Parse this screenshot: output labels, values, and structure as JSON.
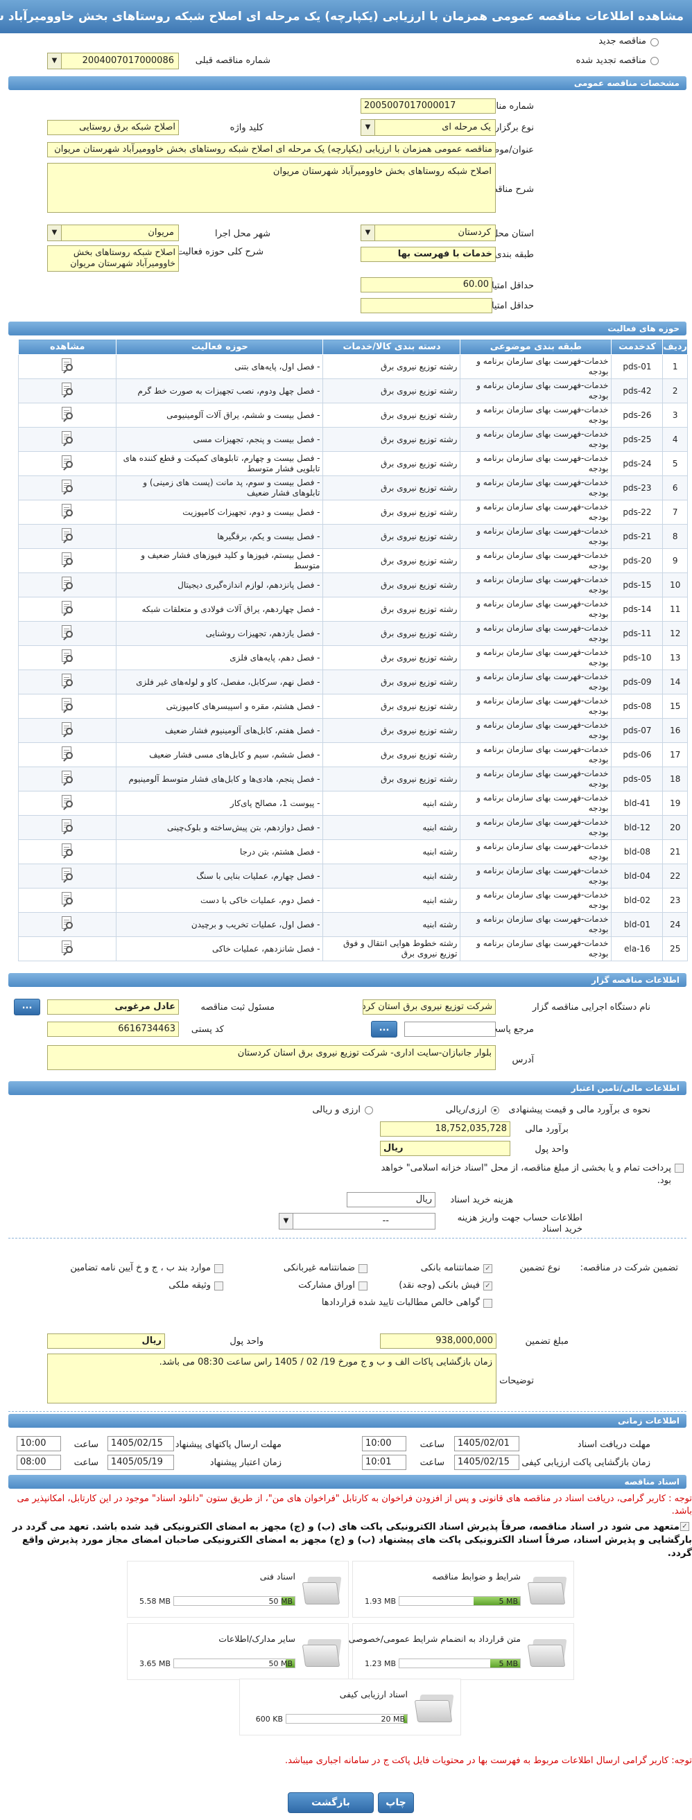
{
  "title": "مشاهده اطلاعات مناقصه عمومی همزمان با ارزیابی (یکپارچه) یک مرحله ای اصلاح شبکه روستاهای بخش خاوومیرآباد شهرستان مریوان",
  "top": {
    "new_tender": "مناقصه جدید",
    "renewed_tender": "مناقصه تجدید شده",
    "prev_number_label": "شماره مناقصه قبلی",
    "prev_number": "2004007017000086"
  },
  "sections": {
    "general": "مشخصات مناقصه عمومی",
    "activity": "حوزه های فعالیت",
    "organizer": "اطلاعات مناقصه گزار",
    "finance": "اطلاعات مالی/تامین اعتبار",
    "timing": "اطلاعات زمانی",
    "docs": "اسناد مناقصه"
  },
  "general": {
    "number_label": "شماره مناقصه",
    "number": "2005007017000017",
    "type_label": "نوع برگزاری",
    "type": "یک مرحله ای",
    "keyword_label": "کلید واژه",
    "keyword": "اصلاح شبکه برق روستایی",
    "subject_label": "عنوان/موضوع مناقصه",
    "subject": "مناقصه عمومی همزمان با ارزیابی (یکپارچه) یک مرحله ای اصلاح شبکه روستاهای بخش خاوومیرآباد شهرستان مریوان",
    "desc_label": "شرح مناقصه",
    "desc": "اصلاح شبکه روستاهای بخش خاوومیرآباد  شهرستان مریوان",
    "province_label": "استان محل اجرا",
    "province": "کردستان",
    "city_label": "شهر محل اجرا",
    "city": "مریوان",
    "category_label": "طبقه بندی موضوعی",
    "category": "خدمات با فهرست بها",
    "activity_desc_label": "شرح کلی حوزه فعالیت",
    "activity_desc": "اصلاح شبکه روستاهای بخش خاوومیرآباد  شهرستان مریوان",
    "min_quality_label": "حداقل امتیاز قابل قبول ارزیابی کیفی",
    "min_quality": "60.00",
    "min_tech_label": "حداقل امتیاز قابل قبول ارزیابی فنی/بازرگانی",
    "min_tech": ""
  },
  "table": {
    "headers": [
      "ردیف",
      "کدخدمت",
      "طبقه بندی موضوعی",
      "دسته بندی کالا/خدمات",
      "حوزه فعالیت",
      "مشاهده"
    ],
    "rows": [
      [
        "1",
        "pds-01",
        "خدمات-فهرست بهای سازمان برنامه و بودجه",
        "رشته توزیع نیروی برق",
        "- فصل اول، پایه‌های بتنی"
      ],
      [
        "2",
        "pds-42",
        "خدمات-فهرست بهای سازمان برنامه و بودجه",
        "رشته توزیع نیروی برق",
        "- فصل چهل ودوم، نصب تجهیزات به صورت خط گرم"
      ],
      [
        "3",
        "pds-26",
        "خدمات-فهرست بهای سازمان برنامه و بودجه",
        "رشته توزیع نیروی برق",
        "- فصل بیست و ششم، یراق آلات آلومینیومی"
      ],
      [
        "4",
        "pds-25",
        "خدمات-فهرست بهای سازمان برنامه و بودجه",
        "رشته توزیع نیروی برق",
        "- فصل بیست و پنجم، تجهیزات مسی"
      ],
      [
        "5",
        "pds-24",
        "خدمات-فهرست بهای سازمان برنامه و بودجه",
        "رشته توزیع نیروی برق",
        "- فصل بیست و چهارم، تابلوهای کمپکت و قطع کننده های تابلویی فشار متوسط"
      ],
      [
        "6",
        "pds-23",
        "خدمات-فهرست بهای سازمان برنامه و بودجه",
        "رشته توزیع نیروی برق",
        "- فصل بیست و سوم، پد مانت (پست های زمینی) و تابلوهای فشار ضعیف"
      ],
      [
        "7",
        "pds-22",
        "خدمات-فهرست بهای سازمان برنامه و بودجه",
        "رشته توزیع نیروی برق",
        "- فصل بیست و دوم، تجهیزات کامپوزیت"
      ],
      [
        "8",
        "pds-21",
        "خدمات-فهرست بهای سازمان برنامه و بودجه",
        "رشته توزیع نیروی برق",
        "- فصل بیست و یکم، برقگیرها"
      ],
      [
        "9",
        "pds-20",
        "خدمات-فهرست بهای سازمان برنامه و بودجه",
        "رشته توزیع نیروی برق",
        "- فصل بیستم، فیوزها و کلید فیوزهای فشار ضعیف و متوسط"
      ],
      [
        "10",
        "pds-15",
        "خدمات-فهرست بهای سازمان برنامه و بودجه",
        "رشته توزیع نیروی برق",
        "- فصل پانزدهم، لوازم اندازه‌گیری دیجیتال"
      ],
      [
        "11",
        "pds-14",
        "خدمات-فهرست بهای سازمان برنامه و بودجه",
        "رشته توزیع نیروی برق",
        "- فصل چهاردهم، یراق آلات فولادی و متعلقات شبکه"
      ],
      [
        "12",
        "pds-11",
        "خدمات-فهرست بهای سازمان برنامه و بودجه",
        "رشته توزیع نیروی برق",
        "- فصل یازدهم، تجهیزات روشنایی"
      ],
      [
        "13",
        "pds-10",
        "خدمات-فهرست بهای سازمان برنامه و بودجه",
        "رشته توزیع نیروی برق",
        "- فصل دهم، پایه‌های فلزی"
      ],
      [
        "14",
        "pds-09",
        "خدمات-فهرست بهای سازمان برنامه و بودجه",
        "رشته توزیع نیروی برق",
        "- فصل نهم، سرکابل، مفصل، کاو و لوله‌های غیر فلزی"
      ],
      [
        "15",
        "pds-08",
        "خدمات-فهرست بهای سازمان برنامه و بودجه",
        "رشته توزیع نیروی برق",
        "- فصل هشتم، مقره و اسپیسرهای کامپوزیتی"
      ],
      [
        "16",
        "pds-07",
        "خدمات-فهرست بهای سازمان برنامه و بودجه",
        "رشته توزیع نیروی برق",
        "- فصل هفتم، کابل‌های آلومینیوم فشار ضعیف"
      ],
      [
        "17",
        "pds-06",
        "خدمات-فهرست بهای سازمان برنامه و بودجه",
        "رشته توزیع نیروی برق",
        "- فصل ششم، سیم و کابل‌های مسی فشار ضعیف"
      ],
      [
        "18",
        "pds-05",
        "خدمات-فهرست بهای سازمان برنامه و بودجه",
        "رشته توزیع نیروی برق",
        "- فصل پنجم، هادی‌ها و کابل‌های فشار متوسط آلومینیوم"
      ],
      [
        "19",
        "bld-41",
        "خدمات-فهرست بهای سازمان برنامه و بودجه",
        "رشته ابنیه",
        "- پیوست 1، مصالح پای‌کار"
      ],
      [
        "20",
        "bld-12",
        "خدمات-فهرست بهای سازمان برنامه و بودجه",
        "رشته ابنیه",
        "- فصل دوازدهم، بتن پیش‌ساخته و بلوک‌چینی"
      ],
      [
        "21",
        "bld-08",
        "خدمات-فهرست بهای سازمان برنامه و بودجه",
        "رشته ابنیه",
        "- فصل هشتم، بتن درجا"
      ],
      [
        "22",
        "bld-04",
        "خدمات-فهرست بهای سازمان برنامه و بودجه",
        "رشته ابنیه",
        "- فصل چهارم، عملیات بنایی با سنگ"
      ],
      [
        "23",
        "bld-02",
        "خدمات-فهرست بهای سازمان برنامه و بودجه",
        "رشته ابنیه",
        "- فصل دوم، عملیات خاکی با دست"
      ],
      [
        "24",
        "bld-01",
        "خدمات-فهرست بهای سازمان برنامه و بودجه",
        "رشته ابنیه",
        "- فصل اول، عملیات تخریب و برچیدن"
      ],
      [
        "25",
        "ela-16",
        "خدمات-فهرست بهای سازمان برنامه و بودجه",
        "رشته خطوط هوایی انتقال و فوق توزیع نیروی برق",
        "- فصل شانزدهم، عملیات خاکی"
      ]
    ]
  },
  "organizer": {
    "device_label": "نام دستگاه اجرایی مناقصه گزار",
    "device": "شرکت توزیع نیروی برق استان کردستان",
    "registrar_label": "مسئول ثبت مناقصه",
    "registrar": "عادل مرغوبی",
    "ref_label": "مرجع پاسخگویی",
    "ref": "",
    "postal_label": "کد پستی",
    "postal": "6616734463",
    "address_label": "آدرس",
    "address": "بلوار جانبازان-سایت اداری- شرکت توزیع نیروی برق استان کردستان",
    "btn": "..."
  },
  "finance": {
    "estimate_method_label": "نحوه ی برآورد مالی و قیمت پیشنهادی",
    "opt_rial": "ارزی/ریالی",
    "opt_rial_currency": "ارزی و ریالی",
    "estimate_label": "برآورد مالی",
    "estimate": "18,752,035,728",
    "currency_label": "واحد پول",
    "currency": "ریال",
    "treasury_note": "پرداخت تمام و یا بخشی از مبلغ مناقصه، از محل \"اسناد خزانه اسلامی\" خواهد بود.",
    "doc_cost_label": "هزینه خرید اسناد",
    "doc_cost_unit": "ریال",
    "account_label": "اطلاعات حساب جهت واریز هزینه خرید اسناد",
    "account": "--",
    "guarantee_label": "تضمین شرکت در مناقصه:",
    "guarantee_type_label": "نوع تضمین",
    "g_bank": "ضمانتنامه بانکی",
    "g_nonbank": "ضمانتنامه غیربانکی",
    "g_cases": "موارد بند ب ، ج و خ آیین نامه تضامین",
    "g_check": "فیش بانکی (وجه نقد)",
    "g_bonds": "اوراق مشارکت",
    "g_property": "وثیقه ملکی",
    "g_claims": "گواهی خالص مطالبات تایید شده قراردادها",
    "amount_label": "مبلغ تضمین",
    "amount": "938,000,000",
    "amount_currency_label": "واحد پول",
    "amount_currency": "ریال",
    "notes_label": "توضیحات",
    "notes": "زمان بازگشایی پاکات الف و ب و ج مورخ 19/ 02 / 1405 راس ساعت 08:30 می باشد."
  },
  "timing": {
    "receive_label": "مهلت دریافت اسناد",
    "receive_date": "1405/02/01",
    "receive_time": "10:00",
    "send_label": "مهلت ارسال پاکتهای پیشنهاد",
    "send_date": "1405/02/15",
    "send_time": "10:00",
    "quality_open_label": "زمان بازگشایی پاکت ارزیابی کیفی",
    "quality_open_date": "1405/02/15",
    "quality_open_time": "10:01",
    "validity_label": "زمان اعتبار پیشنهاد",
    "validity_date": "1405/05/19",
    "validity_time": "08:00",
    "time_label": "ساعت"
  },
  "docs": {
    "note1": "توجه : کاربر گرامی، دریافت اسناد در مناقصه های قانونی و پس از افزودن فراخوان به کارتابل \"فراخوان های من\"، از طریق ستون \"دانلود اسناد\" موجود در این کارتابل، امکانپذیر می باشد.",
    "note2": "متعهد می شود در اسناد مناقصه، صرفاً پذیرش اسناد الکترونیکی پاکت های (ب) و (ج) مجهز به امضای الکترونیکی قید شده باشد. تعهد می گردد در بارگشایی و پذیرش اسناد، صرفاً اسناد الکترونیکی پاکت های پیشنهاد (ب) و (ج) مجهز به امضای الکترونیکی صاحبان امضای مجاز مورد پذیرش واقع گردد.",
    "items": [
      {
        "name": "شرایط و ضوابط مناقصه",
        "size": "1.93 MB",
        "max": "5 MB",
        "fill": 0.386
      },
      {
        "name": "اسناد فنی",
        "size": "5.58 MB",
        "max": "50 MB",
        "fill": 0.112
      },
      {
        "name": "متن قرارداد به انضمام شرایط عمومی/خصوصی",
        "size": "1.23 MB",
        "max": "5 MB",
        "fill": 0.246
      },
      {
        "name": "سایر مدارک/اطلاعات",
        "size": "3.65 MB",
        "max": "50 MB",
        "fill": 0.073
      },
      {
        "name": "اسناد ارزیابی کیفی",
        "size": "600 KB",
        "max": "20 MB",
        "fill": 0.03
      }
    ],
    "note3": "توجه: کاربر گرامی ارسال اطلاعات مربوط به فهرست بها در محتویات فایل پاکت ج در سامانه اجباری میباشد."
  },
  "footer": {
    "print": "چاپ",
    "back": "بازگشت"
  },
  "colors": {
    "header": "#4f8cc6",
    "field": "#ffffc8",
    "red_note": "#d40000"
  }
}
